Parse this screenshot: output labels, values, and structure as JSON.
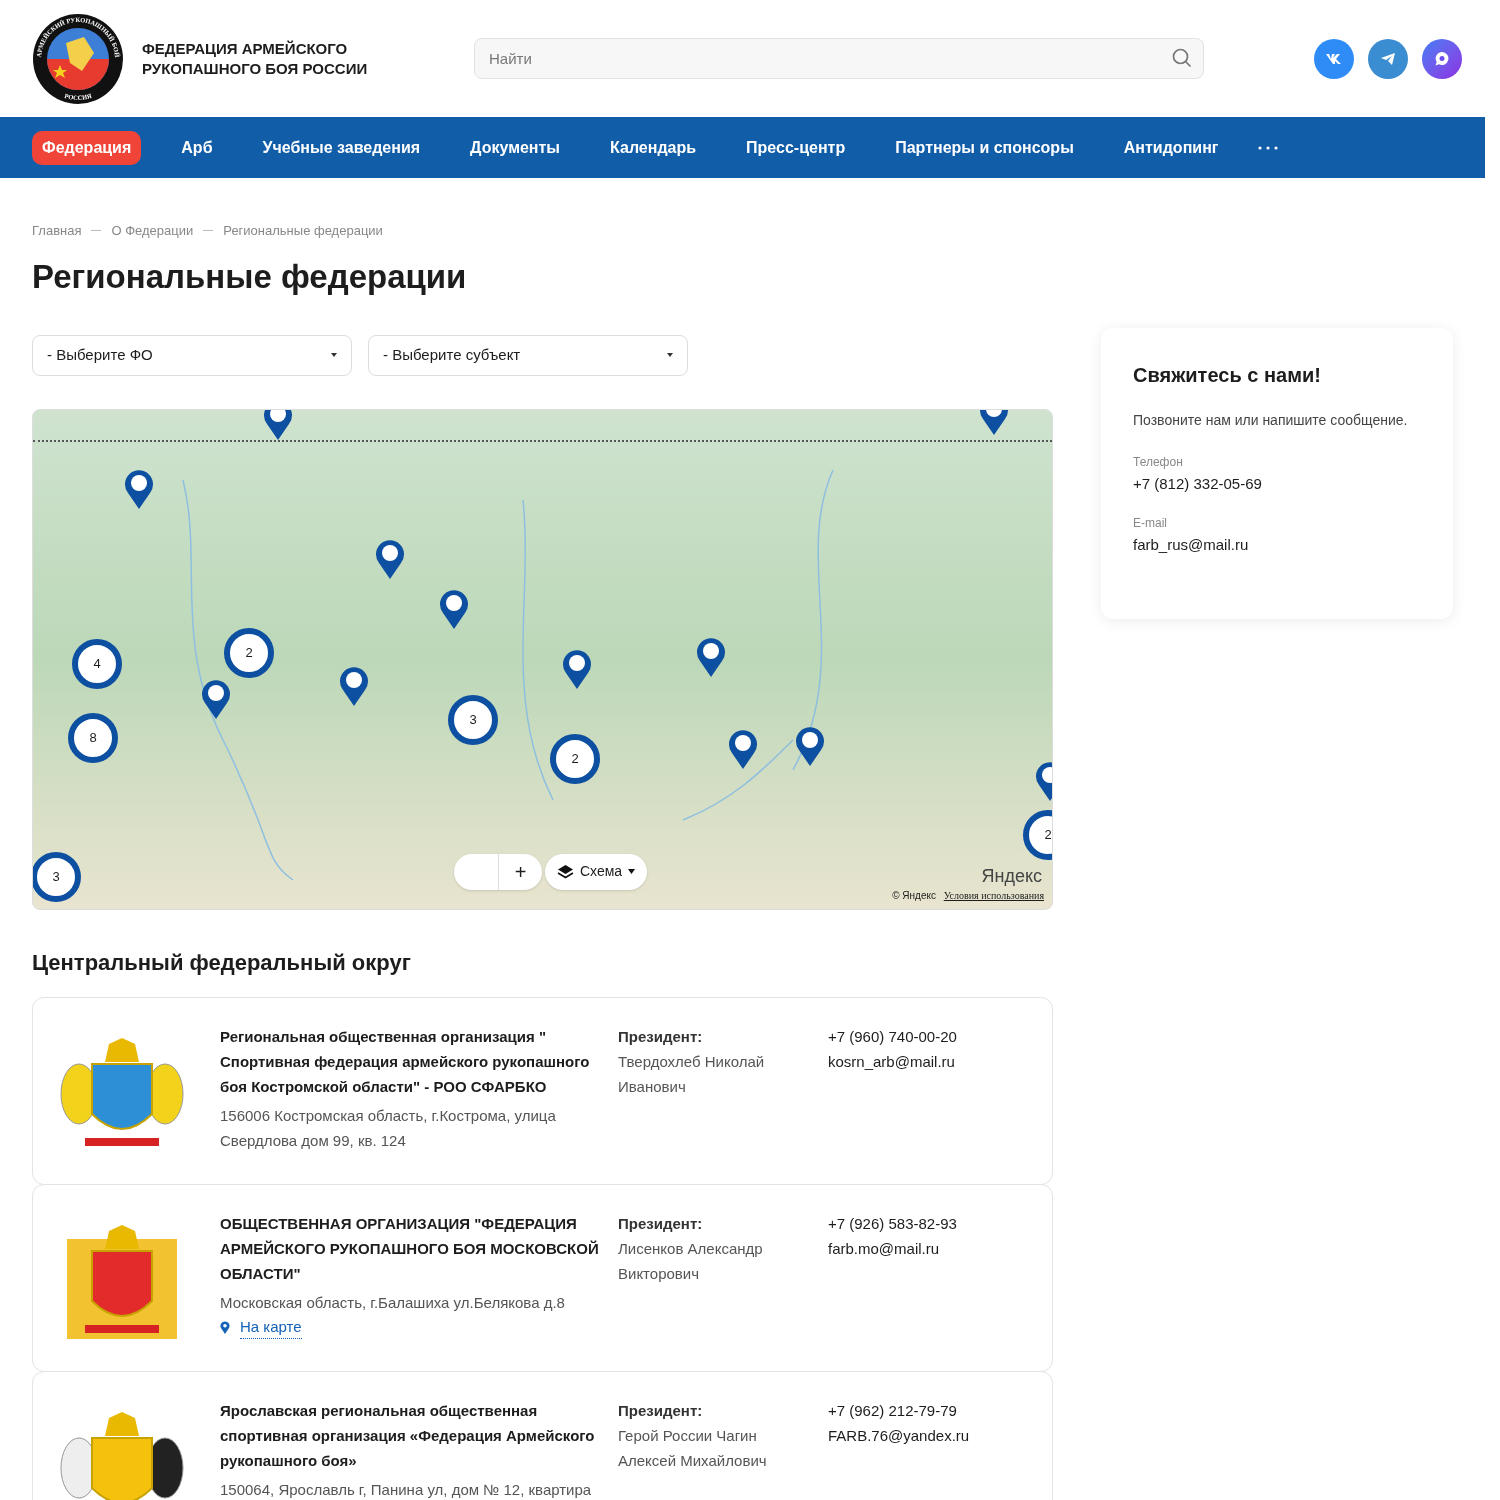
{
  "header": {
    "logo_text_top": "АРМЕЙСКИЙ РУКОПАШНЫЙ БОЙ",
    "logo_text_bottom": "РОССИЯ",
    "title_lines": [
      "ФЕДЕРАЦИЯ АРМЕЙСКОГО",
      "РУКОПАШНОГО БОЯ РОССИИ"
    ],
    "search": {
      "placeholder": "Найти"
    }
  },
  "nav": [
    {
      "label": "Федерация",
      "selected": true
    },
    {
      "label": "Арб",
      "selected": false
    },
    {
      "label": "Учебные заведения",
      "selected": false
    },
    {
      "label": "Документы",
      "selected": false
    },
    {
      "label": "Календарь",
      "selected": false
    },
    {
      "label": "Пресс-центр",
      "selected": false
    },
    {
      "label": "Партнеры и спонсоры",
      "selected": false
    },
    {
      "label": "Антидопинг",
      "selected": false
    }
  ],
  "breadcrumbs": [
    "Главная",
    "О Федерации",
    "Региональные федерации"
  ],
  "title": "Региональные федерации",
  "filters": [
    "- Выберите ФО",
    "- Выберите субъект"
  ],
  "map": {
    "clusters": [
      {
        "label": "4"
      },
      {
        "label": "2"
      },
      {
        "label": "8"
      },
      {
        "label": "3"
      },
      {
        "label": "2"
      },
      {
        "label": "3"
      },
      {
        "label": "2"
      }
    ],
    "zoom_in": "+",
    "layers": "Схема",
    "brand": "Яндекс",
    "copyright": "© Яндекс",
    "terms": "Условия использования"
  },
  "section_title": "Центральный федеральный округ",
  "organizations": [
    {
      "kind": "kostroma",
      "name": "Региональная общественная организация \" Спортивная федерация армейского рукопашного боя Костромской области\" - РОО СФАРБКО",
      "address": "156006 Костромская область, г.Кострома, улица Свердлова дом 99, кв. 124",
      "president_label": "Президент:",
      "president": "Твердохлеб Николай Иванович",
      "phone": "+7 (960) 740-00-20",
      "email": "kosrn_arb@mail.ru"
    },
    {
      "kind": "moscow",
      "name": "ОБЩЕСТВЕННАЯ ОРГАНИЗАЦИЯ \"ФЕДЕРАЦИЯ АРМЕЙСКОГО РУКОПАШНОГО БОЯ МОСКОВСКОЙ ОБЛАСТИ\"",
      "address": "Московская область, г.Балашиха ул.Белякова д.8",
      "map_link": "На карте",
      "president_label": "Президент:",
      "president": "Лисенков Александр Викторович",
      "phone": "+7 (926) 583-82-93",
      "email": "farb.mo@mail.ru"
    },
    {
      "kind": "yaroslavl",
      "name": "Ярославская региональная общественная спортивная организация «Федерация Армейского рукопашного боя»",
      "address": "150064, Ярославль г, Панина ул, дом № 12, квартира",
      "president_label": "Президент:",
      "president": "Герой России Чагин Алексей Михайлович",
      "phone": "+7 (962) 212-79-79",
      "email": "FARB.76@yandex.ru"
    }
  ],
  "contact": {
    "title": "Свяжитесь с нами!",
    "text": "Позвоните нам или напишите сообщение.",
    "phone_label": "Телефон",
    "phone": "+7 (812) 332-05-69",
    "email_label": "E-mail",
    "email": "farb_rus@mail.ru"
  }
}
